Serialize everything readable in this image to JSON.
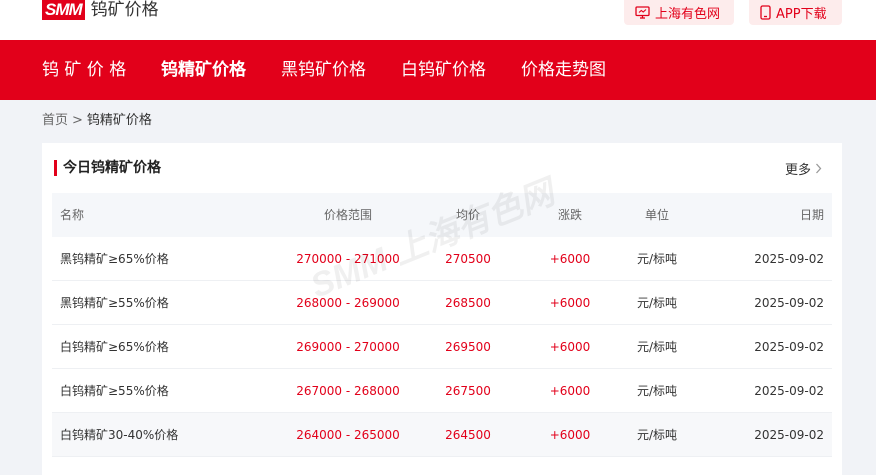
{
  "header": {
    "logo_mark": "SMM",
    "logo_text": "钨矿价格",
    "btn_smm": "上海有色网",
    "btn_app": "APP下载"
  },
  "nav": {
    "items": [
      {
        "label": "钨 矿 价 格"
      },
      {
        "label": "钨精矿价格"
      },
      {
        "label": "黑钨矿价格"
      },
      {
        "label": "白钨矿价格"
      },
      {
        "label": "价格走势图"
      }
    ],
    "active_index": 1
  },
  "breadcrumb": {
    "home": "首页",
    "separator": ">",
    "current": "钨精矿价格"
  },
  "card": {
    "title": "今日钨精矿价格",
    "more": "更多",
    "watermark": "SMM 上海有色网"
  },
  "table": {
    "headers": {
      "name": "名称",
      "range": "价格范围",
      "avg": "均价",
      "change": "涨跌",
      "unit": "单位",
      "date": "日期"
    },
    "rows": [
      {
        "name": "黑钨精矿≥65%价格",
        "range": "270000 - 271000",
        "avg": "270500",
        "change": "+6000",
        "unit": "元/标吨",
        "date": "2025-09-02"
      },
      {
        "name": "黑钨精矿≥55%价格",
        "range": "268000 - 269000",
        "avg": "268500",
        "change": "+6000",
        "unit": "元/标吨",
        "date": "2025-09-02"
      },
      {
        "name": "白钨精矿≥65%价格",
        "range": "269000 - 270000",
        "avg": "269500",
        "change": "+6000",
        "unit": "元/标吨",
        "date": "2025-09-02"
      },
      {
        "name": "白钨精矿≥55%价格",
        "range": "267000 - 268000",
        "avg": "267500",
        "change": "+6000",
        "unit": "元/标吨",
        "date": "2025-09-02"
      },
      {
        "name": "白钨精矿30-40%价格",
        "range": "264000 - 265000",
        "avg": "264500",
        "change": "+6000",
        "unit": "元/标吨",
        "date": "2025-09-02"
      }
    ]
  },
  "colors": {
    "brand": "#e2001a",
    "page_bg": "#f1f3f7",
    "header_row_bg": "#f5f7fa"
  },
  "icons": {
    "smm": "monitor-icon",
    "app": "phone-icon",
    "more": "chevron-right-icon"
  }
}
